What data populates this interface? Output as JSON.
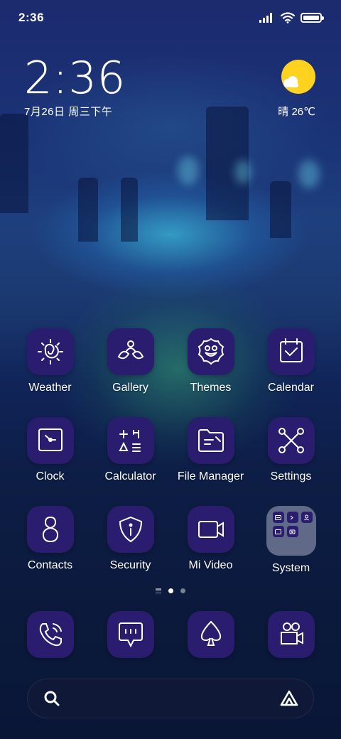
{
  "status_bar": {
    "time": "2:36",
    "signal_icon": "signal-icon",
    "wifi_icon": "wifi-icon",
    "battery_icon": "battery-icon",
    "battery_level": 1.0
  },
  "clock_widget": {
    "time": "2:36",
    "date": "7月26日 周三下午"
  },
  "weather_widget": {
    "icon": "sun-cloud-icon",
    "condition_temp": "晴 26℃"
  },
  "apps": [
    {
      "label": "Weather",
      "icon": "weather-icon"
    },
    {
      "label": "Gallery",
      "icon": "gallery-icon"
    },
    {
      "label": "Themes",
      "icon": "themes-icon"
    },
    {
      "label": "Calendar",
      "icon": "calendar-icon"
    },
    {
      "label": "Clock",
      "icon": "clock-icon"
    },
    {
      "label": "Calculator",
      "icon": "calculator-icon"
    },
    {
      "label": "File Manager",
      "icon": "folder-icon"
    },
    {
      "label": "Settings",
      "icon": "settings-icon"
    },
    {
      "label": "Contacts",
      "icon": "contacts-icon"
    },
    {
      "label": "Security",
      "icon": "security-icon"
    },
    {
      "label": "Mi Video",
      "icon": "video-icon"
    },
    {
      "label": "System",
      "icon": "system-folder-icon"
    }
  ],
  "page_indicator": {
    "pages": 2,
    "current": 1
  },
  "dock": [
    {
      "icon": "phone-icon"
    },
    {
      "icon": "messages-icon"
    },
    {
      "icon": "browser-icon"
    },
    {
      "icon": "camera-icon"
    }
  ],
  "search_bar": {
    "search_icon": "search-icon",
    "assistant_icon": "assistant-icon"
  },
  "colors": {
    "icon_background": "#2a1c6e",
    "sun": "#ffd21f",
    "text": "#ffffff"
  }
}
